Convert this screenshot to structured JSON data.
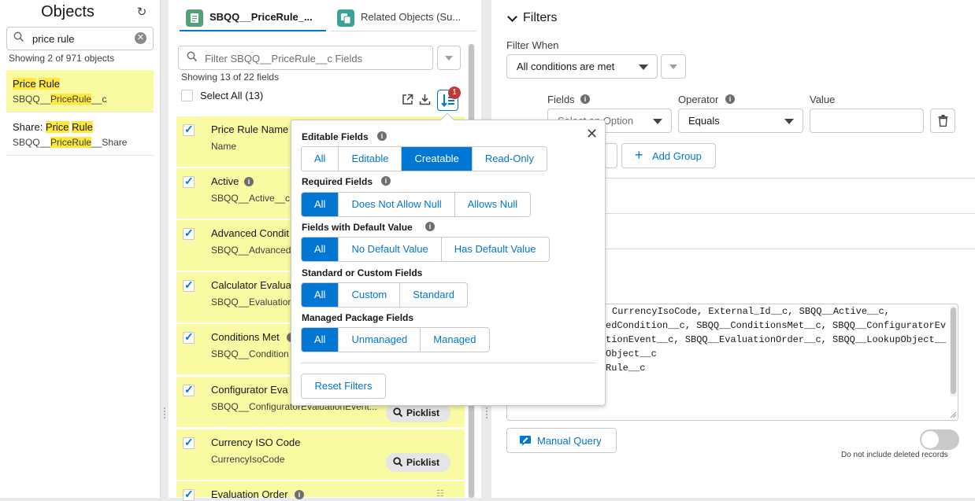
{
  "objects_panel": {
    "title": "Objects",
    "search_value": "price rule",
    "count_text": "Showing 2 of 971 objects",
    "items": [
      {
        "label_pre": "",
        "label_m1": "Price",
        "label_mid": " ",
        "label_m2": "Rule",
        "label_post": "",
        "api_pre": "SBQQ__",
        "api_m": "PriceRule",
        "api_post": "__c"
      },
      {
        "label_pre": "Share: ",
        "label_m1": "Price",
        "label_mid": " ",
        "label_m2": "Rule",
        "label_post": "",
        "api_pre": "SBQQ__",
        "api_m": "PriceRule",
        "api_post": "__Share"
      }
    ]
  },
  "fields_panel": {
    "tabs": [
      {
        "label": "SBQQ__PriceRule_..."
      },
      {
        "label": "Related Objects (Su..."
      }
    ],
    "filter_placeholder": "Filter SBQQ__PriceRule__c Fields",
    "showing_text": "Showing 13 of 22 fields",
    "select_all_label": "Select All (13)",
    "filter_badge": "1",
    "fields": [
      {
        "name": "Price Rule Name",
        "api": "Name"
      },
      {
        "name": "Active",
        "api": "SBQQ__Active__c"
      },
      {
        "name": "Advanced Condit",
        "api": "SBQQ__Advanced"
      },
      {
        "name": "Calculator Evalua",
        "api": "SBQQ__Evaluation"
      },
      {
        "name": "Conditions Met",
        "api": "SBQQ__Condition"
      },
      {
        "name": "Configurator Eva",
        "api": "SBQQ__ConfiguratorEvaluationEvent...",
        "pill": "Picklist"
      },
      {
        "name": "Currency ISO Code",
        "api": "CurrencyIsoCode",
        "pill": "Picklist"
      },
      {
        "name": "Evaluation Order",
        "api": ""
      }
    ]
  },
  "filters_panel": {
    "title": "Filters",
    "filter_when_label": "Filter When",
    "filter_when_value": "All conditions are met",
    "fields_label": "Fields",
    "field_placeholder": "Select an Option",
    "operator_label": "Operator",
    "operator_value": "Equals",
    "value_label": "Value",
    "add_group_label": "Add Group",
    "query_lines": [
      "CurrencyIsoCode, External_Id__c, SBQQ__Active__c,",
      "edCondition__c, SBQQ__ConditionsMet__c, SBQQ__ConfiguratorEv",
      "tionEvent__c, SBQQ__EvaluationOrder__c, SBQQ__LookupObject__",
      "Object__c",
      "Rule__c"
    ],
    "manual_query_label": "Manual Query",
    "deleted_toggle_label": "Do not include deleted records"
  },
  "popover": {
    "sections": [
      {
        "title": "Editable Fields",
        "options": [
          "All",
          "Editable",
          "Creatable",
          "Read-Only"
        ],
        "selected": 2
      },
      {
        "title": "Required Fields",
        "options": [
          "All",
          "Does Not Allow Null",
          "Allows Null"
        ],
        "selected": 0
      },
      {
        "title": "Fields with Default Value",
        "options": [
          "All",
          "No Default Value",
          "Has Default Value"
        ],
        "selected": 0
      },
      {
        "title": "Standard or Custom Fields",
        "options": [
          "All",
          "Custom",
          "Standard"
        ],
        "selected": 0
      },
      {
        "title": "Managed Package Fields",
        "options": [
          "All",
          "Unmanaged",
          "Managed"
        ],
        "selected": 0
      }
    ],
    "reset_label": "Reset Filters"
  },
  "colors": {
    "brand": "#0176d3",
    "highlight_row": "#fafaa3",
    "match_mark": "#ffe83d",
    "badge": "#c23934"
  }
}
